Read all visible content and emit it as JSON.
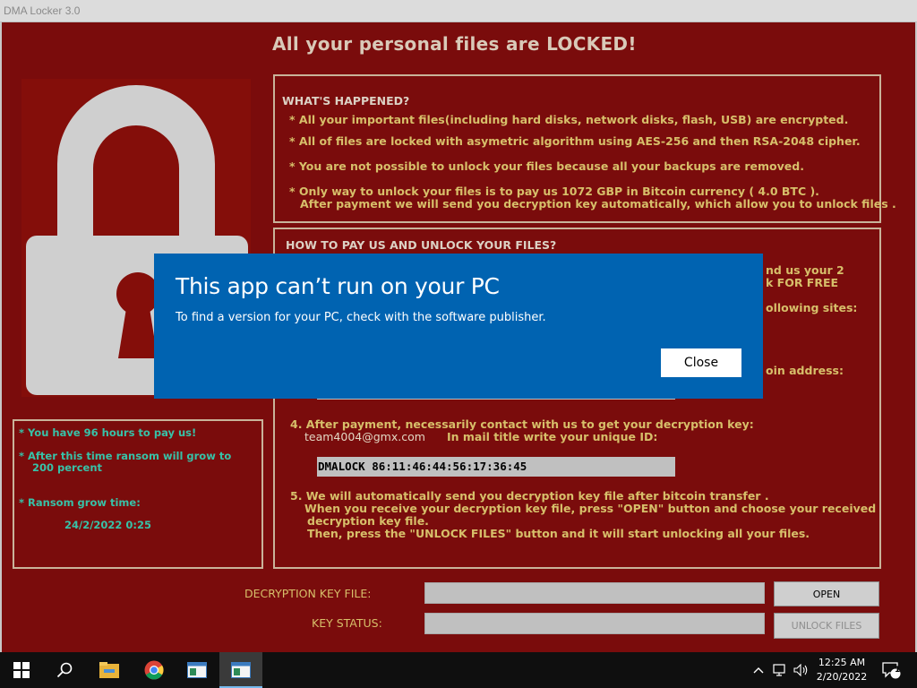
{
  "window": {
    "title": "DMA Locker 3.0"
  },
  "app": {
    "headline": "All your personal files are LOCKED!",
    "happened": {
      "heading": "WHAT'S HAPPENED?",
      "lines": [
        "* All your important files(including hard disks, network disks, flash, USB) are encrypted.",
        "* All of files are locked with asymetric algorithm using AES-256 and then RSA-2048 cipher.",
        "* You are not possible to unlock your files because all your backups are removed.",
        "* Only way to unlock your files is to pay us   1072 GBP in Bitcoin currency ( 4.0 BTC ).",
        "After payment we will send you decryption key automatically, which allow you to unlock files ."
      ]
    },
    "howto": {
      "heading": "HOW TO PAY US AND UNLOCK YOUR FILES?",
      "partial": [
        "nd us your 2",
        "k FOR FREE",
        "ollowing sites:",
        "oin address:"
      ],
      "step4": "4. After payment, necessarily contact with us to get your decryption key:",
      "email": "team4004@gmx.com",
      "mail_title_note": "In mail title write your unique ID:",
      "unique_id": "DMALOCK 86:11:46:44:56:17:36:45",
      "step5": [
        "5. We will automatically send you decryption key file after bitcoin transfer .",
        "When you receive your decryption key file, press \"OPEN\"  button and choose your received",
        "decryption key file.",
        "Then,  press the \"UNLOCK FILES\" button and it will start unlocking all your files."
      ]
    },
    "timer": {
      "line1": "* You have 96 hours to pay us!",
      "line2a": "* After this time ransom will grow to",
      "line2b": "200 percent",
      "line3": "* Ransom grow time:",
      "time": "24/2/2022 0:25"
    },
    "bottom": {
      "key_file_label": "DECRYPTION KEY FILE:",
      "key_status_label": "KEY STATUS:",
      "open_button": "OPEN",
      "unlock_button": "UNLOCK FILES"
    }
  },
  "dialog": {
    "title": "This app can’t run on your PC",
    "message": "To find a version for your PC, check with the software publisher.",
    "close_label": "Close"
  },
  "taskbar": {
    "time": "12:25 AM",
    "date": "2/20/2022",
    "notification_count": "1",
    "icons": [
      "windows-start-icon",
      "search-icon",
      "file-explorer-icon",
      "chrome-icon",
      "app-window-icon",
      "app-window-icon"
    ]
  },
  "colors": {
    "background": "#7a0c0c",
    "text_gold": "#d7bf6a",
    "text_teal": "#37c2a8",
    "dialog_blue": "#0063b1"
  }
}
